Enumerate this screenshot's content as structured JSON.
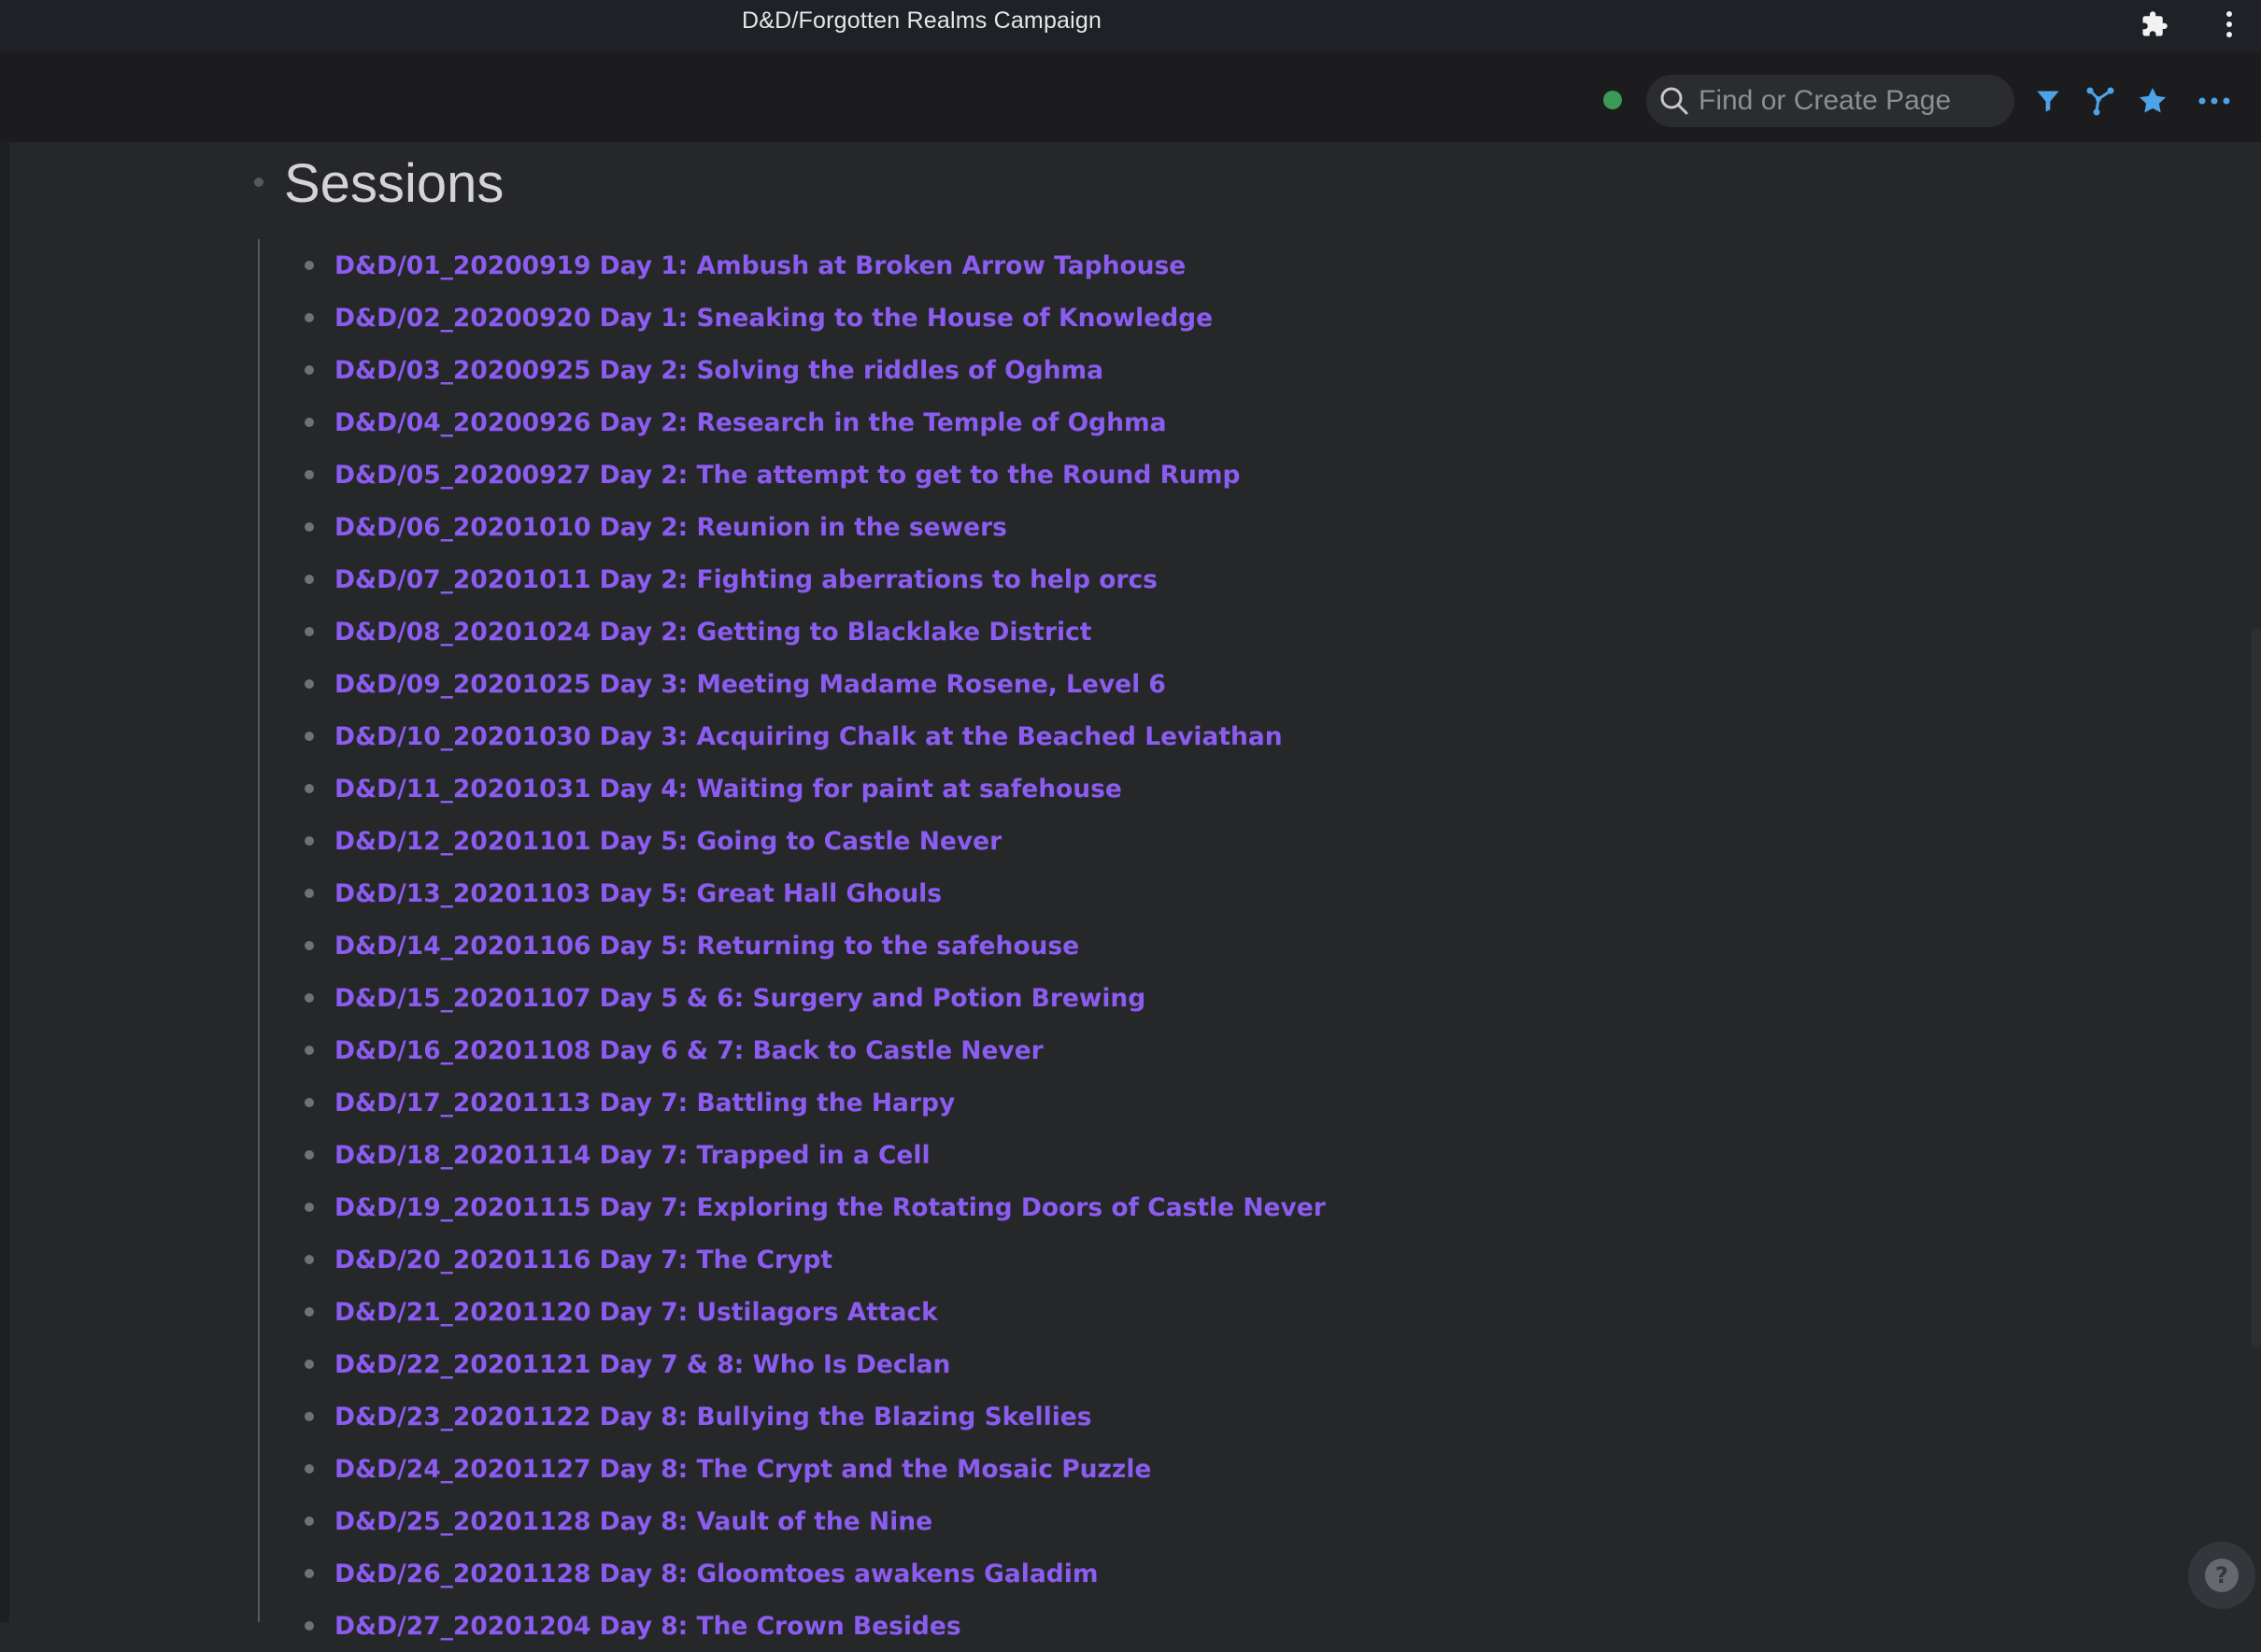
{
  "window": {
    "title": "D&D/Forgotten Realms Campaign"
  },
  "titlebar_icons": [
    "puzzle-icon",
    "kebab-menu-icon"
  ],
  "toolbar": {
    "status": "connected",
    "search_placeholder": "Find or Create Page",
    "search_value": "",
    "buttons": [
      "filter-icon",
      "graph-icon",
      "star-icon",
      "more-icon"
    ],
    "accent_color": "#4ea3e8"
  },
  "page": {
    "heading": "Sessions",
    "link_color": "#8b5cf0",
    "sessions": [
      "D&D/01_20200919 Day 1: Ambush at Broken Arrow Taphouse",
      "D&D/02_20200920 Day 1: Sneaking to the House of Knowledge",
      "D&D/03_20200925 Day 2: Solving the riddles of Oghma",
      "D&D/04_20200926 Day 2: Research in the Temple of Oghma",
      "D&D/05_20200927 Day 2: The attempt to get to the Round Rump",
      "D&D/06_20201010 Day 2: Reunion in the sewers",
      "D&D/07_20201011 Day 2: Fighting aberrations to help orcs",
      "D&D/08_20201024 Day 2: Getting to Blacklake District",
      "D&D/09_20201025 Day 3: Meeting Madame Rosene, Level 6",
      "D&D/10_20201030 Day 3: Acquiring Chalk at the Beached Leviathan",
      "D&D/11_20201031 Day 4: Waiting for paint at safehouse",
      "D&D/12_20201101 Day 5: Going to Castle Never",
      "D&D/13_20201103 Day 5: Great Hall Ghouls",
      "D&D/14_20201106 Day 5: Returning to the safehouse",
      "D&D/15_20201107 Day 5 & 6: Surgery and Potion Brewing",
      "D&D/16_20201108 Day 6 & 7: Back to Castle Never",
      "D&D/17_20201113 Day 7: Battling the Harpy",
      "D&D/18_20201114 Day 7: Trapped in a Cell",
      "D&D/19_20201115 Day 7: Exploring the Rotating Doors of Castle Never",
      "D&D/20_20201116 Day 7: The Crypt",
      "D&D/21_20201120 Day 7: Ustilagors Attack",
      "D&D/22_20201121 Day 7 & 8: Who Is Declan",
      "D&D/23_20201122 Day 8: Bullying the Blazing Skellies",
      "D&D/24_20201127 Day 8: The Crypt and the Mosaic Puzzle",
      "D&D/25_20201128 Day 8: Vault of the Nine",
      "D&D/26_20201128 Day 8: Gloomtoes awakens Galadim",
      "D&D/27_20201204 Day 8: The Crown Besides"
    ]
  },
  "help": {
    "label": "?"
  }
}
